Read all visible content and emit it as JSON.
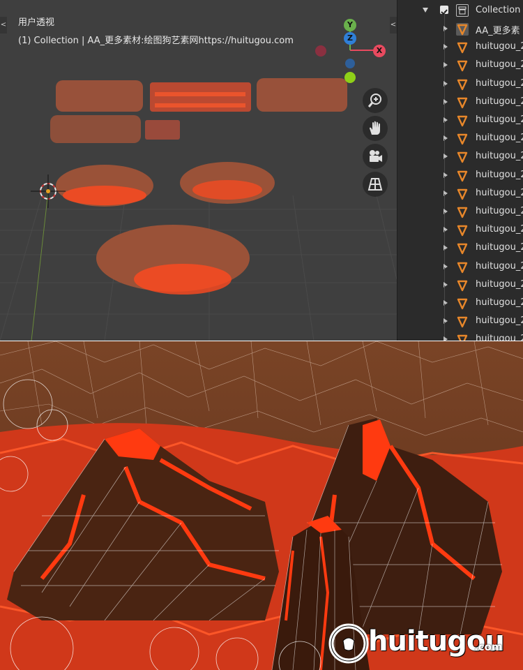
{
  "viewport": {
    "view_name": "用户透视",
    "subtitle": "(1) Collection | AA_更多素材:绘图狗艺素网https://huitugou.com",
    "gizmo": {
      "y_label": "Y",
      "z_label": "Z",
      "x_label": "X"
    },
    "nav_buttons": [
      {
        "name": "zoom-icon"
      },
      {
        "name": "hand-pan-icon"
      },
      {
        "name": "camera-icon"
      },
      {
        "name": "grid-perspective-icon"
      }
    ],
    "side_tab_left": "<",
    "side_tab_right": "<"
  },
  "outliner": {
    "root_label": "Collection",
    "items": [
      {
        "label": "AA_更多素"
      },
      {
        "label": "huitugou_2"
      },
      {
        "label": "huitugou_2"
      },
      {
        "label": "huitugou_2"
      },
      {
        "label": "huitugou_2"
      },
      {
        "label": "huitugou_2"
      },
      {
        "label": "huitugou_2"
      },
      {
        "label": "huitugou_2"
      },
      {
        "label": "huitugou_2"
      },
      {
        "label": "huitugou_2"
      },
      {
        "label": "huitugou_2"
      },
      {
        "label": "huitugou_2"
      },
      {
        "label": "huitugou_2"
      },
      {
        "label": "huitugou_2"
      },
      {
        "label": "huitugou_2"
      },
      {
        "label": "huitugou_2"
      },
      {
        "label": "huitugou_2"
      },
      {
        "label": "huitugou_2"
      }
    ]
  },
  "watermark": {
    "brand": "huitugou",
    "suffix": ".com"
  },
  "colors": {
    "lava": "#ff3b12",
    "rock": "#6e3a22",
    "viewport_bg": "#3f3f3f",
    "outliner_bg": "#2b2b2b",
    "accent_orange": "#e8872a"
  }
}
